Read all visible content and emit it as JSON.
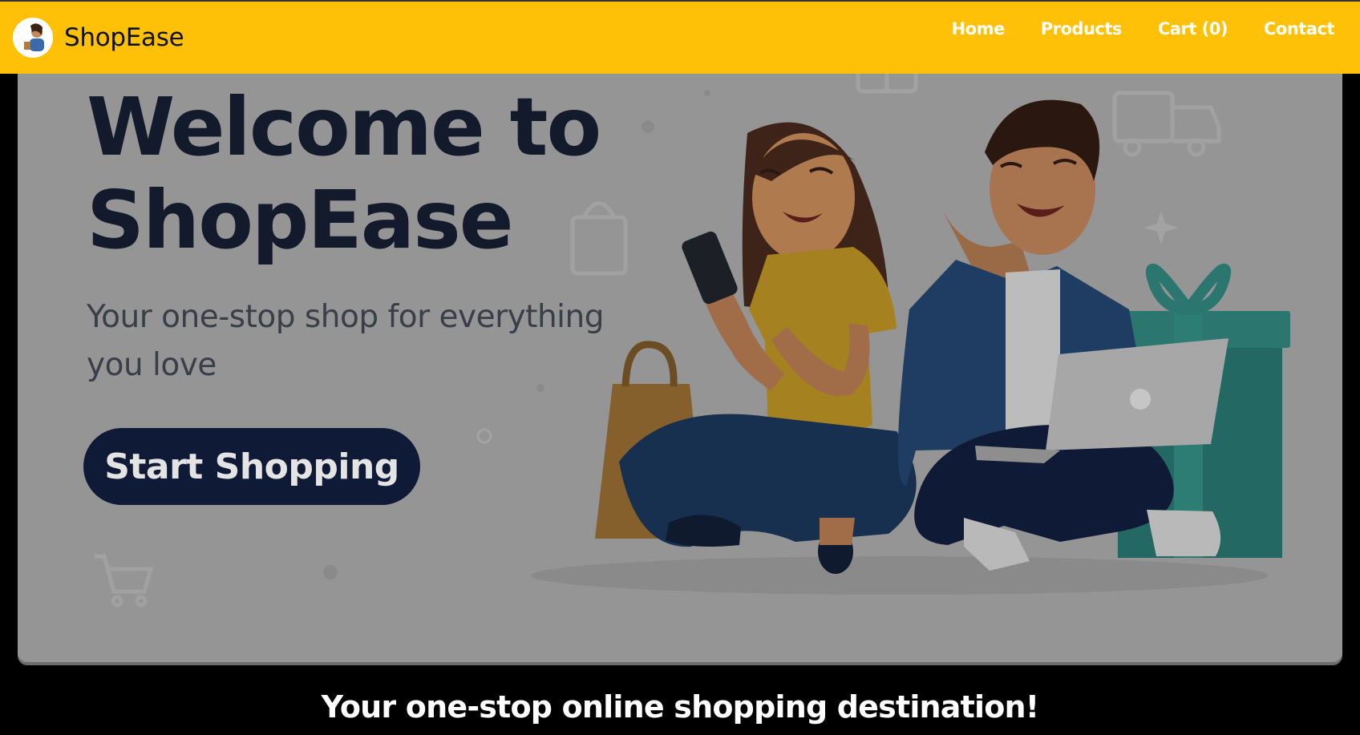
{
  "brand": {
    "name": "ShopEase"
  },
  "nav": {
    "items": [
      {
        "label": "Home"
      },
      {
        "label": "Products"
      },
      {
        "label": "Cart (0)"
      },
      {
        "label": "Contact"
      }
    ]
  },
  "hero": {
    "title_line1": "Welcome to",
    "title_line2": "ShopEase",
    "subtitle": "Your one-stop shop for everything you love",
    "cta_label": "Start Shopping"
  },
  "footer": {
    "tagline": "Your one-stop online shopping destination!"
  },
  "colors": {
    "navbar": "#ffc107",
    "hero_bg": "#959595",
    "title": "#121a2b",
    "cta_bg": "#0f1a36",
    "page_bg": "#000000"
  },
  "icons": [
    "logo-avatar-icon",
    "shopping-bag-icon",
    "gift-box-icon",
    "delivery-truck-icon",
    "shopping-cart-icon",
    "sparkle-icon"
  ]
}
